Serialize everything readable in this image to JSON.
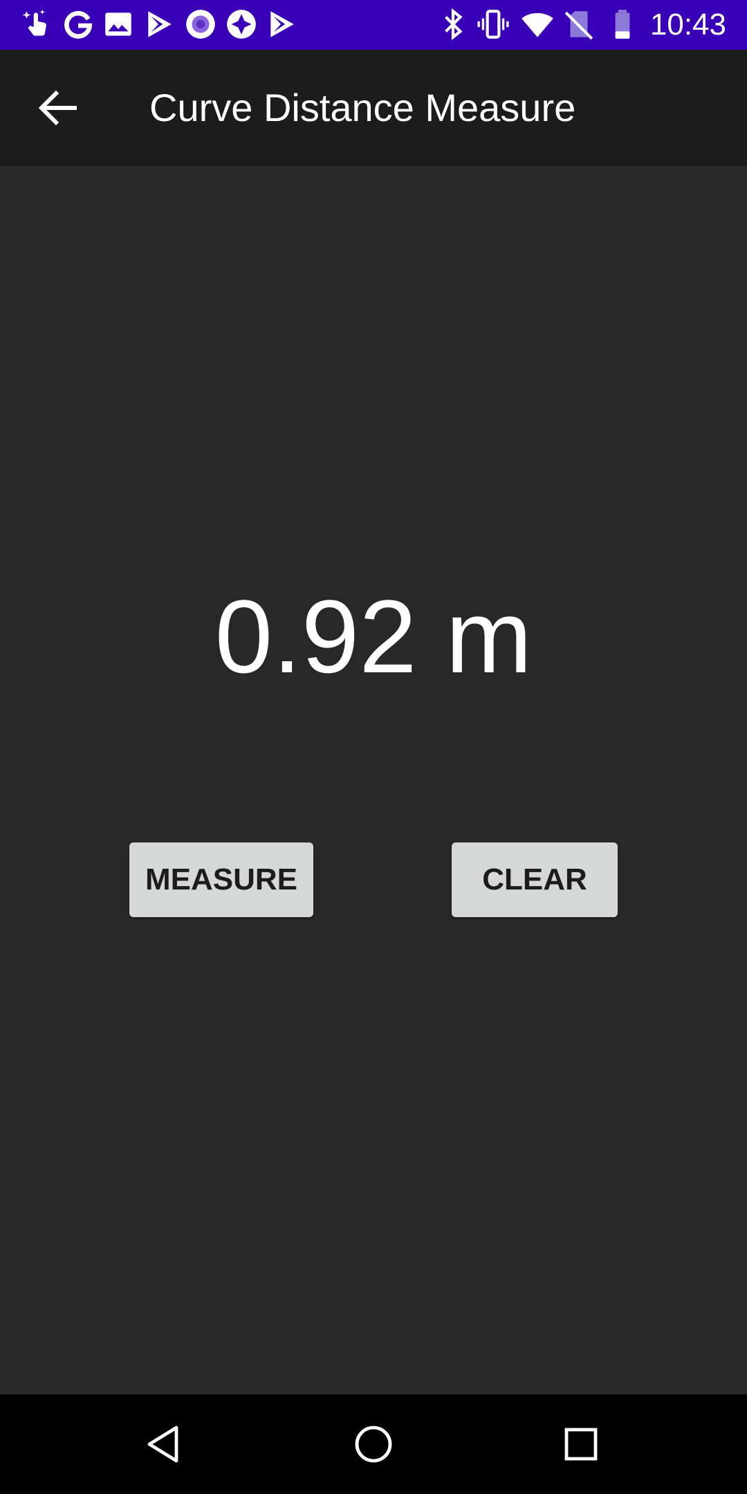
{
  "status_bar": {
    "time": "10:43",
    "left_icons": [
      "hand-pointer-icon",
      "google-icon",
      "image-icon",
      "play-store-icon",
      "circle-app-icon",
      "diamond-app-icon",
      "play-store-icon"
    ],
    "right_icons": [
      "bluetooth-icon",
      "vibrate-icon",
      "wifi-icon",
      "no-sim-icon",
      "battery-icon"
    ],
    "background_color": "#3a00b8"
  },
  "app_bar": {
    "title": "Curve Distance Measure",
    "back_icon": "arrow-back-icon"
  },
  "main": {
    "reading": "0.92 m",
    "buttons": {
      "measure_label": "MEASURE",
      "clear_label": "CLEAR"
    }
  },
  "nav_bar": {
    "icons": [
      "back-triangle-icon",
      "home-circle-icon",
      "recents-square-icon"
    ]
  }
}
